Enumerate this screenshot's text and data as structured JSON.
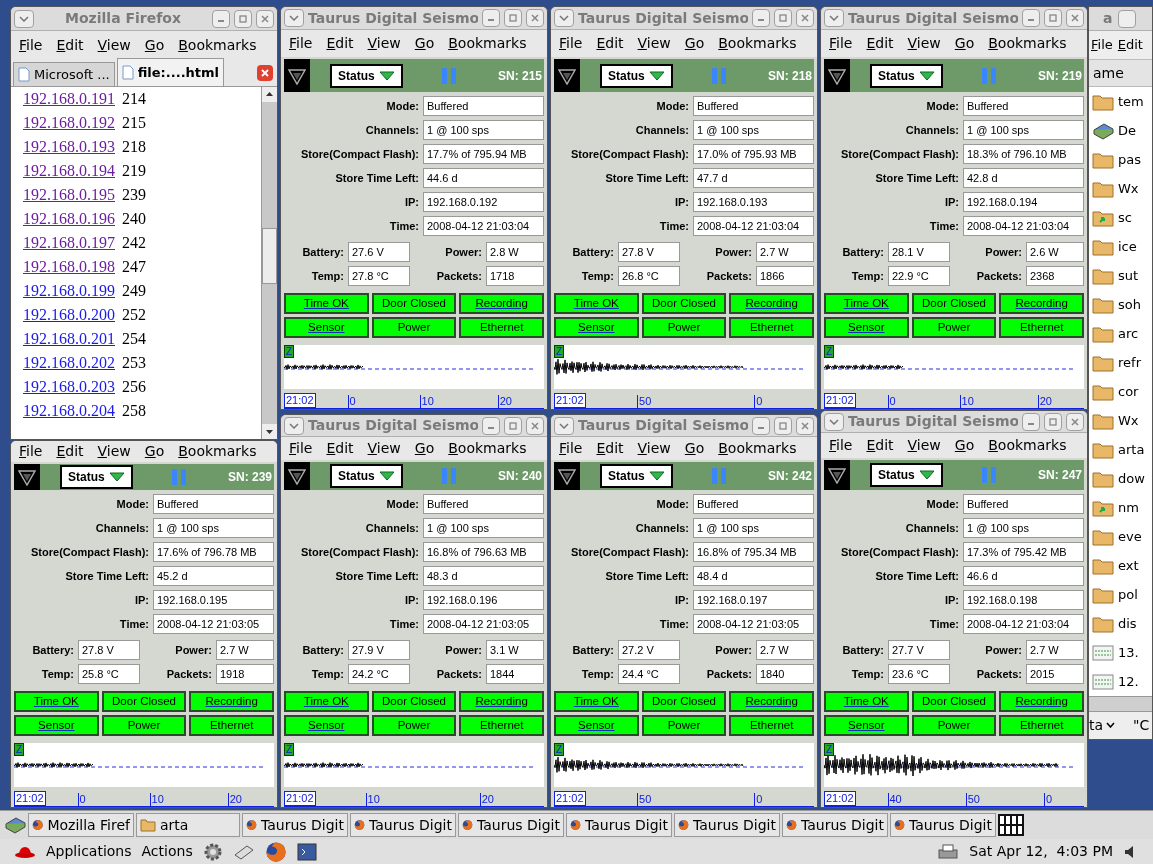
{
  "firefox": {
    "title": "Mozilla Firefox",
    "menu": [
      "File",
      "Edit",
      "View",
      "Go",
      "Bookmarks"
    ],
    "tabs": [
      {
        "label": "Microsoft ...",
        "selected": false
      },
      {
        "label": "file:....html",
        "selected": true
      }
    ],
    "rows": [
      {
        "ip": "192.168.0.191",
        "value": "214",
        "visited": true
      },
      {
        "ip": "192.168.0.192",
        "value": "215",
        "visited": true
      },
      {
        "ip": "192.168.0.193",
        "value": "218",
        "visited": true
      },
      {
        "ip": "192.168.0.194",
        "value": "219",
        "visited": true
      },
      {
        "ip": "192.168.0.195",
        "value": "239",
        "visited": true
      },
      {
        "ip": "192.168.0.196",
        "value": "240",
        "visited": true
      },
      {
        "ip": "192.168.0.197",
        "value": "242",
        "visited": true
      },
      {
        "ip": "192.168.0.198",
        "value": "247",
        "visited": true
      },
      {
        "ip": "192.168.0.199",
        "value": "249",
        "visited": false
      },
      {
        "ip": "192.168.0.200",
        "value": "252",
        "visited": false
      },
      {
        "ip": "192.168.0.201",
        "value": "254",
        "visited": false
      },
      {
        "ip": "192.168.0.202",
        "value": "253",
        "visited": false
      },
      {
        "ip": "192.168.0.203",
        "value": "256",
        "visited": false
      },
      {
        "ip": "192.168.0.204",
        "value": "258",
        "visited": false
      }
    ]
  },
  "seismo_windows": [
    {
      "title": "Taurus Digital Seismo",
      "menu": [
        "File",
        "Edit",
        "View",
        "Go",
        "Bookmarks"
      ],
      "dropdown": "Status",
      "sn": "SN: 215",
      "fields": [
        {
          "label": "Mode:",
          "value": "Buffered"
        },
        {
          "label": "Channels:",
          "value": "1 @ 100 sps"
        },
        {
          "label": "Store(Compact Flash):",
          "value": "17.7% of 795.94 MB"
        },
        {
          "label": "Store Time Left:",
          "value": "44.6 d"
        },
        {
          "label": "IP:",
          "value": "192.168.0.192"
        },
        {
          "label": "Time:",
          "value": "2008-04-12 21:03:04"
        }
      ],
      "readings": [
        {
          "label": "Battery:",
          "value": "27.6 V"
        },
        {
          "label": "Power:",
          "value": "2.8 W"
        },
        {
          "label": "Temp:",
          "value": "27.8 °C"
        },
        {
          "label": "Packets:",
          "value": "1718"
        }
      ],
      "indicators": [
        {
          "label": "Time OK",
          "underlined": true
        },
        {
          "label": "Door Closed",
          "underlined": false
        },
        {
          "label": "Recording",
          "underlined": true
        },
        {
          "label": "Sensor",
          "underlined": true
        },
        {
          "label": "Power",
          "underlined": false
        },
        {
          "label": "Ethernet",
          "underlined": false
        }
      ],
      "waveform": {
        "channel": "Z",
        "time": "21:02",
        "ticks": [
          "0",
          "10",
          "20"
        ]
      }
    },
    {
      "title": "Taurus Digital Seismo",
      "menu": [
        "File",
        "Edit",
        "View",
        "Go",
        "Bookmarks"
      ],
      "dropdown": "Status",
      "sn": "SN: 218",
      "fields": [
        {
          "label": "Mode:",
          "value": "Buffered"
        },
        {
          "label": "Channels:",
          "value": "1 @ 100 sps"
        },
        {
          "label": "Store(Compact Flash):",
          "value": "17.0% of 795.93 MB"
        },
        {
          "label": "Store Time Left:",
          "value": "47.7 d"
        },
        {
          "label": "IP:",
          "value": "192.168.0.193"
        },
        {
          "label": "Time:",
          "value": "2008-04-12 21:03:04"
        }
      ],
      "readings": [
        {
          "label": "Battery:",
          "value": "27.8 V"
        },
        {
          "label": "Power:",
          "value": "2.7 W"
        },
        {
          "label": "Temp:",
          "value": "26.8 °C"
        },
        {
          "label": "Packets:",
          "value": "1866"
        }
      ],
      "indicators": [
        {
          "label": "Time OK",
          "underlined": true
        },
        {
          "label": "Door Closed",
          "underlined": false
        },
        {
          "label": "Recording",
          "underlined": true
        },
        {
          "label": "Sensor",
          "underlined": true
        },
        {
          "label": "Power",
          "underlined": false
        },
        {
          "label": "Ethernet",
          "underlined": false
        }
      ],
      "waveform": {
        "channel": "Z",
        "time": "21:02",
        "ticks": [
          "50",
          "0"
        ]
      }
    },
    {
      "title": "Taurus Digital Seismo",
      "menu": [
        "File",
        "Edit",
        "View",
        "Go",
        "Bookmarks"
      ],
      "dropdown": "Status",
      "sn": "SN: 219",
      "fields": [
        {
          "label": "Mode:",
          "value": "Buffered"
        },
        {
          "label": "Channels:",
          "value": "1 @ 100 sps"
        },
        {
          "label": "Store(Compact Flash):",
          "value": "18.3% of 796.10 MB"
        },
        {
          "label": "Store Time Left:",
          "value": "42.8 d"
        },
        {
          "label": "IP:",
          "value": "192.168.0.194"
        },
        {
          "label": "Time:",
          "value": "2008-04-12 21:03:04"
        }
      ],
      "readings": [
        {
          "label": "Battery:",
          "value": "28.1 V"
        },
        {
          "label": "Power:",
          "value": "2.6 W"
        },
        {
          "label": "Temp:",
          "value": "22.9 °C"
        },
        {
          "label": "Packets:",
          "value": "2368"
        }
      ],
      "indicators": [
        {
          "label": "Time OK",
          "underlined": true
        },
        {
          "label": "Door Closed",
          "underlined": false
        },
        {
          "label": "Recording",
          "underlined": true
        },
        {
          "label": "Sensor",
          "underlined": true
        },
        {
          "label": "Power",
          "underlined": false
        },
        {
          "label": "Ethernet",
          "underlined": false
        }
      ],
      "waveform": {
        "channel": "Z",
        "time": "21:02",
        "ticks": [
          "0",
          "10",
          "20"
        ]
      }
    },
    {
      "menu": [
        "File",
        "Edit",
        "View",
        "Go",
        "Bookmarks"
      ],
      "dropdown": "Status",
      "sn": "SN: 239",
      "fields": [
        {
          "label": "Mode:",
          "value": "Buffered"
        },
        {
          "label": "Channels:",
          "value": "1 @ 100 sps"
        },
        {
          "label": "Store(Compact Flash):",
          "value": "17.6% of 796.78 MB"
        },
        {
          "label": "Store Time Left:",
          "value": "45.2 d"
        },
        {
          "label": "IP:",
          "value": "192.168.0.195"
        },
        {
          "label": "Time:",
          "value": "2008-04-12 21:03:05"
        }
      ],
      "readings": [
        {
          "label": "Battery:",
          "value": "27.8 V"
        },
        {
          "label": "Power:",
          "value": "2.7 W"
        },
        {
          "label": "Temp:",
          "value": "25.8 °C"
        },
        {
          "label": "Packets:",
          "value": "1918"
        }
      ],
      "indicators": [
        {
          "label": "Time OK",
          "underlined": true
        },
        {
          "label": "Door Closed",
          "underlined": false
        },
        {
          "label": "Recording",
          "underlined": true
        },
        {
          "label": "Sensor",
          "underlined": true
        },
        {
          "label": "Power",
          "underlined": false
        },
        {
          "label": "Ethernet",
          "underlined": false
        }
      ],
      "waveform": {
        "channel": "Z",
        "time": "21:02",
        "ticks": [
          "0",
          "10",
          "20"
        ]
      }
    },
    {
      "title": "Taurus Digital Seismo",
      "menu": [
        "File",
        "Edit",
        "View",
        "Go",
        "Bookmarks"
      ],
      "dropdown": "Status",
      "sn": "SN: 240",
      "fields": [
        {
          "label": "Mode:",
          "value": "Buffered"
        },
        {
          "label": "Channels:",
          "value": "1 @ 100 sps"
        },
        {
          "label": "Store(Compact Flash):",
          "value": "16.8% of 796.63 MB"
        },
        {
          "label": "Store Time Left:",
          "value": "48.3 d"
        },
        {
          "label": "IP:",
          "value": "192.168.0.196"
        },
        {
          "label": "Time:",
          "value": "2008-04-12 21:03:05"
        }
      ],
      "readings": [
        {
          "label": "Battery:",
          "value": "27.9 V"
        },
        {
          "label": "Power:",
          "value": "3.1 W"
        },
        {
          "label": "Temp:",
          "value": "24.2 °C"
        },
        {
          "label": "Packets:",
          "value": "1844"
        }
      ],
      "indicators": [
        {
          "label": "Time OK",
          "underlined": true
        },
        {
          "label": "Door Closed",
          "underlined": false
        },
        {
          "label": "Recording",
          "underlined": true
        },
        {
          "label": "Sensor",
          "underlined": true
        },
        {
          "label": "Power",
          "underlined": false
        },
        {
          "label": "Ethernet",
          "underlined": false
        }
      ],
      "waveform": {
        "channel": "Z",
        "time": "21:02",
        "ticks": [
          "10",
          "20"
        ]
      }
    },
    {
      "title": "Taurus Digital Seismo",
      "menu": [
        "File",
        "Edit",
        "View",
        "Go",
        "Bookmarks"
      ],
      "dropdown": "Status",
      "sn": "SN: 242",
      "fields": [
        {
          "label": "Mode:",
          "value": "Buffered"
        },
        {
          "label": "Channels:",
          "value": "1 @ 100 sps"
        },
        {
          "label": "Store(Compact Flash):",
          "value": "16.8% of 795.34 MB"
        },
        {
          "label": "Store Time Left:",
          "value": "48.4 d"
        },
        {
          "label": "IP:",
          "value": "192.168.0.197"
        },
        {
          "label": "Time:",
          "value": "2008-04-12 21:03:05"
        }
      ],
      "readings": [
        {
          "label": "Battery:",
          "value": "27.2 V"
        },
        {
          "label": "Power:",
          "value": "2.7 W"
        },
        {
          "label": "Temp:",
          "value": "24.4 °C"
        },
        {
          "label": "Packets:",
          "value": "1840"
        }
      ],
      "indicators": [
        {
          "label": "Time OK",
          "underlined": true
        },
        {
          "label": "Door Closed",
          "underlined": false
        },
        {
          "label": "Recording",
          "underlined": true
        },
        {
          "label": "Sensor",
          "underlined": true
        },
        {
          "label": "Power",
          "underlined": false
        },
        {
          "label": "Ethernet",
          "underlined": false
        }
      ],
      "waveform": {
        "channel": "Z",
        "time": "21:02",
        "ticks": [
          "50",
          "0"
        ]
      }
    },
    {
      "title": "Taurus Digital Seismo",
      "menu": [
        "File",
        "Edit",
        "View",
        "Go",
        "Bookmarks"
      ],
      "dropdown": "Status",
      "sn": "SN: 247",
      "fields": [
        {
          "label": "Mode:",
          "value": "Buffered"
        },
        {
          "label": "Channels:",
          "value": "1 @ 100 sps"
        },
        {
          "label": "Store(Compact Flash):",
          "value": "17.3% of 795.42 MB"
        },
        {
          "label": "Store Time Left:",
          "value": "46.6 d"
        },
        {
          "label": "IP:",
          "value": "192.168.0.198"
        },
        {
          "label": "Time:",
          "value": "2008-04-12 21:03:04"
        }
      ],
      "readings": [
        {
          "label": "Battery:",
          "value": "27.7 V"
        },
        {
          "label": "Power:",
          "value": "2.7 W"
        },
        {
          "label": "Temp:",
          "value": "23.6 °C"
        },
        {
          "label": "Packets:",
          "value": "2015"
        }
      ],
      "indicators": [
        {
          "label": "Time OK",
          "underlined": true
        },
        {
          "label": "Door Closed",
          "underlined": false
        },
        {
          "label": "Recording",
          "underlined": true
        },
        {
          "label": "Sensor",
          "underlined": true
        },
        {
          "label": "Power",
          "underlined": false
        },
        {
          "label": "Ethernet",
          "underlined": false
        }
      ],
      "waveform": {
        "channel": "Z",
        "time": "21:02",
        "ticks": [
          "40",
          "50",
          "0"
        ]
      }
    }
  ],
  "file_manager": {
    "title": "a",
    "menu": [
      "File",
      "Edit"
    ],
    "column": "ame",
    "items": [
      {
        "name": "tem",
        "kind": "folder"
      },
      {
        "name": "De",
        "kind": "desktop"
      },
      {
        "name": "pas",
        "kind": "folder"
      },
      {
        "name": "Wx",
        "kind": "folder"
      },
      {
        "name": "sc",
        "kind": "shared"
      },
      {
        "name": "ice",
        "kind": "folder"
      },
      {
        "name": "sut",
        "kind": "folder"
      },
      {
        "name": "soh",
        "kind": "folder"
      },
      {
        "name": "arc",
        "kind": "folder"
      },
      {
        "name": "refr",
        "kind": "folder"
      },
      {
        "name": "cor",
        "kind": "folder"
      },
      {
        "name": "Wx",
        "kind": "folder"
      },
      {
        "name": "arta",
        "kind": "folder"
      },
      {
        "name": "dow",
        "kind": "folder"
      },
      {
        "name": "nm",
        "kind": "shared"
      },
      {
        "name": "eve",
        "kind": "folder"
      },
      {
        "name": "ext",
        "kind": "folder"
      },
      {
        "name": "pol",
        "kind": "folder"
      },
      {
        "name": "dis",
        "kind": "folder"
      },
      {
        "name": "13.",
        "kind": "data"
      },
      {
        "name": "12.",
        "kind": "data"
      }
    ],
    "footer": [
      "ta",
      "\"C"
    ]
  },
  "taskbar": [
    {
      "label": "Mozilla Firef",
      "kind": "browser"
    },
    {
      "label": "arta",
      "kind": "folder"
    },
    {
      "label": "Taurus Digit",
      "kind": "browser"
    },
    {
      "label": "Taurus Digit",
      "kind": "browser"
    },
    {
      "label": "Taurus Digit",
      "kind": "browser"
    },
    {
      "label": "Taurus Digit",
      "kind": "browser"
    },
    {
      "label": "Taurus Digit",
      "kind": "browser"
    },
    {
      "label": "Taurus Digit",
      "kind": "browser"
    },
    {
      "label": "Taurus Digit",
      "kind": "browser"
    }
  ],
  "panel": {
    "menus": [
      "Applications",
      "Actions"
    ],
    "clock": "Sat Apr 12,  4:03 PM"
  }
}
